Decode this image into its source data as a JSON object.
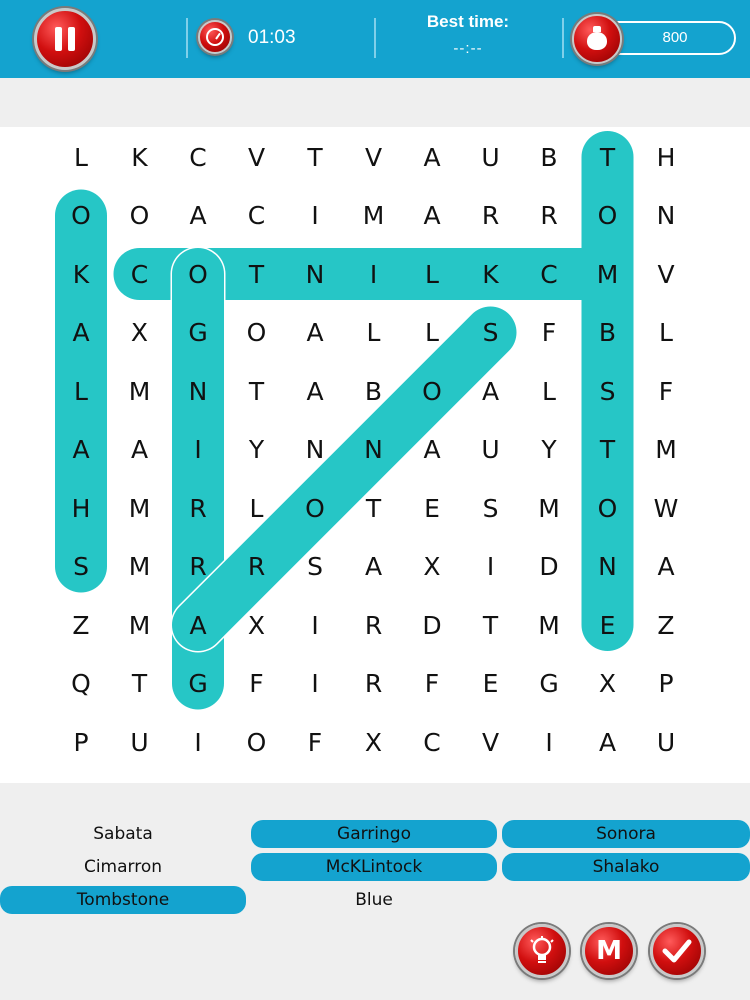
{
  "header": {
    "timer": "01:03",
    "best_time_label": "Best time:",
    "best_time_value": "--:--",
    "coins": "800"
  },
  "grid": {
    "rows": [
      [
        "L",
        "K",
        "C",
        "V",
        "T",
        "V",
        "A",
        "U",
        "B",
        "T",
        "H"
      ],
      [
        "O",
        "O",
        "A",
        "C",
        "I",
        "M",
        "A",
        "R",
        "R",
        "O",
        "N"
      ],
      [
        "K",
        "C",
        "O",
        "T",
        "N",
        "I",
        "L",
        "K",
        "C",
        "M",
        "V"
      ],
      [
        "A",
        "X",
        "G",
        "O",
        "A",
        "L",
        "L",
        "S",
        "F",
        "B",
        "L"
      ],
      [
        "L",
        "M",
        "N",
        "T",
        "A",
        "B",
        "O",
        "A",
        "L",
        "S",
        "F"
      ],
      [
        "A",
        "A",
        "I",
        "Y",
        "N",
        "N",
        "A",
        "U",
        "Y",
        "T",
        "M"
      ],
      [
        "H",
        "M",
        "R",
        "L",
        "O",
        "T",
        "E",
        "S",
        "M",
        "O",
        "W"
      ],
      [
        "S",
        "M",
        "R",
        "R",
        "S",
        "A",
        "X",
        "I",
        "D",
        "N",
        "A"
      ],
      [
        "Z",
        "M",
        "A",
        "X",
        "I",
        "R",
        "D",
        "T",
        "M",
        "E",
        "Z"
      ],
      [
        "Q",
        "T",
        "G",
        "F",
        "I",
        "R",
        "F",
        "E",
        "G",
        "X",
        "P"
      ],
      [
        "P",
        "U",
        "I",
        "O",
        "F",
        "X",
        "C",
        "V",
        "I",
        "A",
        "U"
      ]
    ],
    "highlights": [
      {
        "word": "Shalako",
        "from": [
          7,
          0
        ],
        "to": [
          1,
          0
        ]
      },
      {
        "word": "McKLintock",
        "from": [
          2,
          9
        ],
        "to": [
          2,
          1
        ]
      },
      {
        "word": "Garringo",
        "from": [
          9,
          2
        ],
        "to": [
          2,
          2
        ]
      },
      {
        "word": "Tombstone",
        "from": [
          0,
          9
        ],
        "to": [
          8,
          9
        ]
      },
      {
        "word": "Sonora",
        "from": [
          3,
          7
        ],
        "to": [
          8,
          2
        ]
      }
    ]
  },
  "words": [
    {
      "label": "Sabata",
      "found": false
    },
    {
      "label": "Garringo",
      "found": true
    },
    {
      "label": "Sonora",
      "found": true
    },
    {
      "label": "Cimarron",
      "found": false
    },
    {
      "label": "McKLintock",
      "found": true
    },
    {
      "label": "Shalako",
      "found": true
    },
    {
      "label": "Tombstone",
      "found": true
    },
    {
      "label": "Blue",
      "found": false
    }
  ],
  "icons": {
    "pause": "pause-icon",
    "timer": "stopwatch-icon",
    "coins": "money-bag-icon",
    "hint": "lightbulb-icon",
    "m": "m-letter-icon",
    "check": "checkmark-icon"
  },
  "colors": {
    "header": "#14a3cf",
    "highlight": "#26c6c6",
    "found_word": "#14a3cf",
    "button_red": "#d10f0f"
  }
}
